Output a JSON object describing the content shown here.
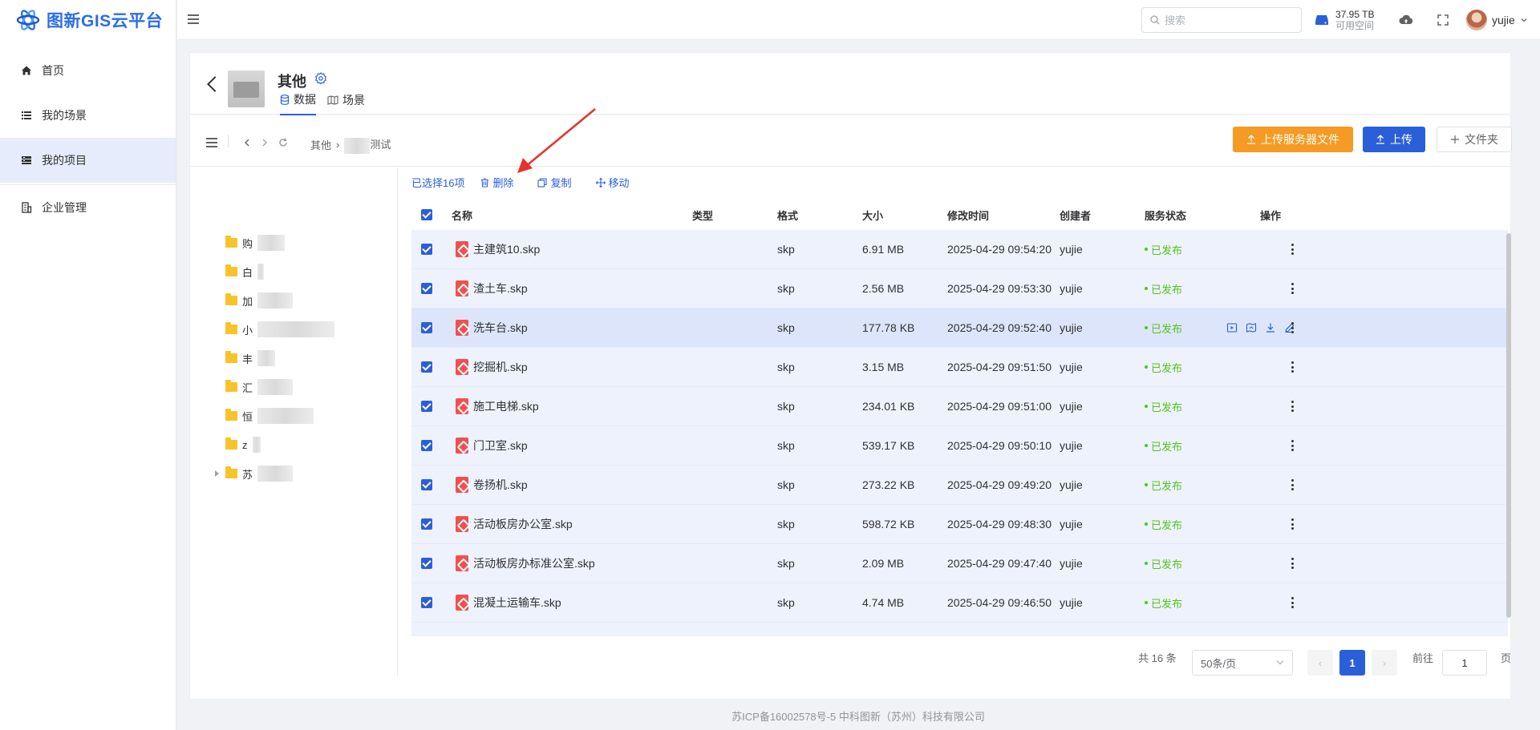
{
  "app": {
    "logo_text": "图新GIS云平台"
  },
  "sidebar": {
    "items": [
      {
        "label": "首页",
        "icon": "home-icon"
      },
      {
        "label": "我的场景",
        "icon": "list-icon"
      },
      {
        "label": "我的项目",
        "icon": "project-icon",
        "active": true
      },
      {
        "label": "企业管理",
        "icon": "enterprise-icon"
      }
    ]
  },
  "header": {
    "search_placeholder": "搜索",
    "storage_size": "37.95 TB",
    "storage_label": "可用空间",
    "username": "yujie"
  },
  "project": {
    "title": "其他",
    "tabs": [
      {
        "label": "数据",
        "active": true
      },
      {
        "label": "场景",
        "active": false
      }
    ]
  },
  "toolbar": {
    "breadcrumb_root": "其他",
    "breadcrumb_current": "测试",
    "upload_server_label": "上传服务器文件",
    "upload_label": "上传",
    "folder_label": "文件夹"
  },
  "tree": {
    "items": [
      "购",
      "白",
      "加",
      "小",
      "丰",
      "汇",
      "恒",
      "z",
      "苏"
    ]
  },
  "selection": {
    "count_label": "已选择16项",
    "delete_label": "删除",
    "copy_label": "复制",
    "move_label": "移动"
  },
  "table": {
    "columns": [
      "名称",
      "类型",
      "格式",
      "大小",
      "修改时间",
      "创建者",
      "服务状态",
      "操作"
    ],
    "rows": [
      {
        "name": "主建筑10.skp",
        "format": "skp",
        "size": "6.91 MB",
        "modified": "2025-04-29 09:54:20",
        "creator": "yujie",
        "status": "已发布"
      },
      {
        "name": "渣土车.skp",
        "format": "skp",
        "size": "2.56 MB",
        "modified": "2025-04-29 09:53:30",
        "creator": "yujie",
        "status": "已发布"
      },
      {
        "name": "洗车台.skp",
        "format": "skp",
        "size": "177.78 KB",
        "modified": "2025-04-29 09:52:40",
        "creator": "yujie",
        "status": "已发布"
      },
      {
        "name": "挖掘机.skp",
        "format": "skp",
        "size": "3.15 MB",
        "modified": "2025-04-29 09:51:50",
        "creator": "yujie",
        "status": "已发布"
      },
      {
        "name": "施工电梯.skp",
        "format": "skp",
        "size": "234.01 KB",
        "modified": "2025-04-29 09:51:00",
        "creator": "yujie",
        "status": "已发布"
      },
      {
        "name": "门卫室.skp",
        "format": "skp",
        "size": "539.17 KB",
        "modified": "2025-04-29 09:50:10",
        "creator": "yujie",
        "status": "已发布"
      },
      {
        "name": "卷扬机.skp",
        "format": "skp",
        "size": "273.22 KB",
        "modified": "2025-04-29 09:49:20",
        "creator": "yujie",
        "status": "已发布"
      },
      {
        "name": "活动板房办公室.skp",
        "format": "skp",
        "size": "598.72 KB",
        "modified": "2025-04-29 09:48:30",
        "creator": "yujie",
        "status": "已发布"
      },
      {
        "name": "活动板房办标准公室.skp",
        "format": "skp",
        "size": "2.09 MB",
        "modified": "2025-04-29 09:47:40",
        "creator": "yujie",
        "status": "已发布"
      },
      {
        "name": "混凝土运输车.skp",
        "format": "skp",
        "size": "4.74 MB",
        "modified": "2025-04-29 09:46:50",
        "creator": "yujie",
        "status": "已发布"
      }
    ]
  },
  "pagination": {
    "total_label": "共 16 条",
    "page_size": "50条/页",
    "current_page": "1",
    "goto_label": "前往",
    "goto_value": "1",
    "page_suffix": "页"
  },
  "footer": {
    "text": "苏ICP备16002578号-5 中科图新（苏州）科技有限公司"
  },
  "colors": {
    "primary": "#2b5fd9",
    "orange": "#f59a23",
    "success": "#52c41a",
    "file_red": "#f05050"
  }
}
